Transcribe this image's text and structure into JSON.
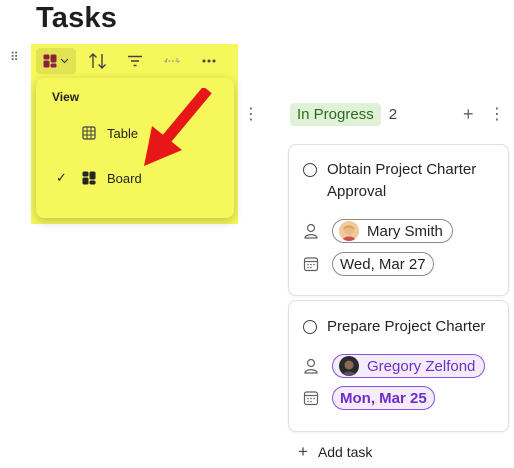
{
  "page": {
    "title": "Tasks"
  },
  "toolbar": {
    "view_icon": "board-icon",
    "sort_icon": "sort-arrows-icon",
    "filter_icon": "filter-icon",
    "width_icon": "column-width-icon",
    "more_icon": "more-horizontal-icon"
  },
  "menu": {
    "header": "View",
    "items": [
      {
        "label": "Table",
        "icon": "table-icon",
        "checked": false
      },
      {
        "label": "Board",
        "icon": "board-icon",
        "checked": true
      }
    ],
    "check_glyph": "✓"
  },
  "column": {
    "name": "In Progress",
    "count": "2",
    "add_glyph": "+",
    "more_glyph": "⋮",
    "cards": [
      {
        "title": "Obtain Project Charter Approval",
        "assignee": "Mary Smith",
        "due": "Wed, Mar 27",
        "highlight": false
      },
      {
        "title": "Prepare Project Charter",
        "assignee": "Gregory Zelfond",
        "due": "Mon, Mar 25",
        "highlight": true
      }
    ],
    "add_task_label": "Add task",
    "add_task_glyph": "+"
  },
  "misc": {
    "drag_glyph": "⠿",
    "more_vertical_glyph": "⋮"
  },
  "colors": {
    "highlight": "#f6f75a",
    "arrow": "#e81717",
    "status_bg": "#dff2d8",
    "accent_purple": "#8f4fe0"
  }
}
